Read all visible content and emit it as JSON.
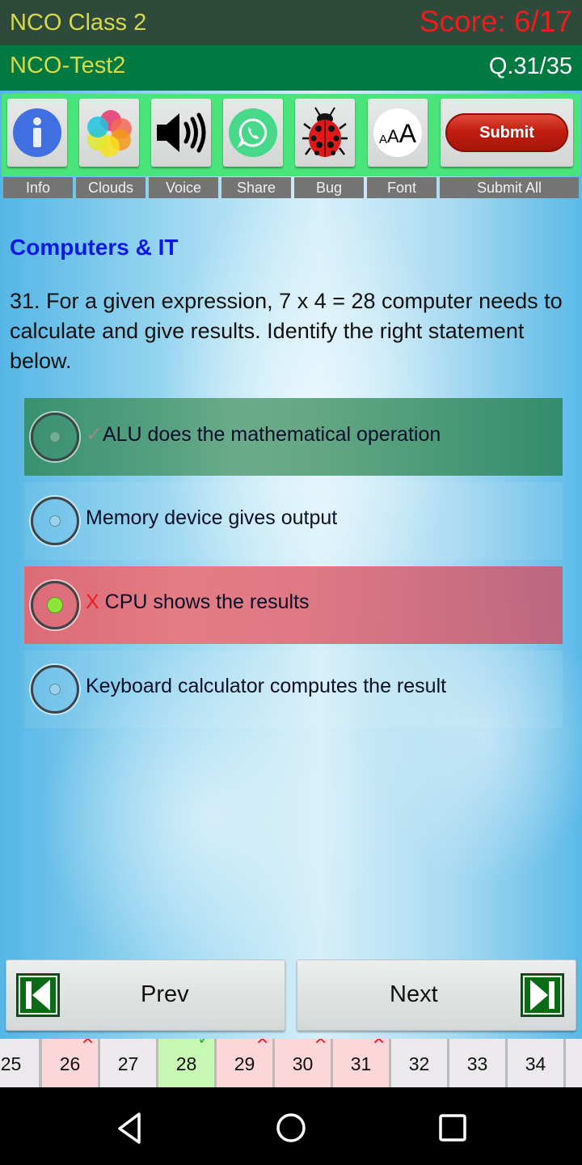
{
  "header": {
    "app_title": "NCO Class 2",
    "score": "Score: 6/17",
    "test_name": "NCO-Test2",
    "question_counter": "Q.31/35"
  },
  "toolbar": {
    "buttons": [
      {
        "label": "Info",
        "icon": "info-icon"
      },
      {
        "label": "Clouds",
        "icon": "clouds-icon"
      },
      {
        "label": "Voice",
        "icon": "speaker-icon"
      },
      {
        "label": "Share",
        "icon": "whatsapp-icon"
      },
      {
        "label": "Bug",
        "icon": "ladybug-icon"
      },
      {
        "label": "Font",
        "icon": "font-size-icon"
      },
      {
        "label": "Submit All",
        "icon": "submit-button",
        "button_text": "Submit"
      }
    ],
    "font_icon_text": "AAA"
  },
  "question": {
    "category": "Computers & IT",
    "text": "31. For a given expression, 7 x 4 = 28 computer needs to calculate and give results. Identify the right statement below.",
    "options": [
      {
        "text": "ALU does the mathematical operation",
        "state": "correct",
        "mark": "✓",
        "selected": false
      },
      {
        "text": "Memory device gives output",
        "state": "none",
        "mark": "",
        "selected": false
      },
      {
        "text": "CPU shows the results",
        "state": "wrong",
        "mark": "X",
        "selected": true
      },
      {
        "text": "Keyboard calculator computes the result",
        "state": "none",
        "mark": "",
        "selected": false
      }
    ]
  },
  "navigation": {
    "prev_label": "Prev",
    "next_label": "Next"
  },
  "question_strip": [
    {
      "num": "25",
      "status": "unanswered"
    },
    {
      "num": "26",
      "status": "wrong"
    },
    {
      "num": "27",
      "status": "unanswered"
    },
    {
      "num": "28",
      "status": "correct"
    },
    {
      "num": "29",
      "status": "wrong"
    },
    {
      "num": "30",
      "status": "wrong"
    },
    {
      "num": "31",
      "status": "wrong"
    },
    {
      "num": "32",
      "status": "unanswered"
    },
    {
      "num": "33",
      "status": "unanswered"
    },
    {
      "num": "34",
      "status": "unanswered"
    }
  ],
  "colors": {
    "score": "#ee1c1c",
    "title": "#d7d94a",
    "category": "#0a18e6",
    "toolbar_bg": "#4ae57a",
    "correct_option": "#3f9a72",
    "wrong_option": "#e06c78"
  }
}
